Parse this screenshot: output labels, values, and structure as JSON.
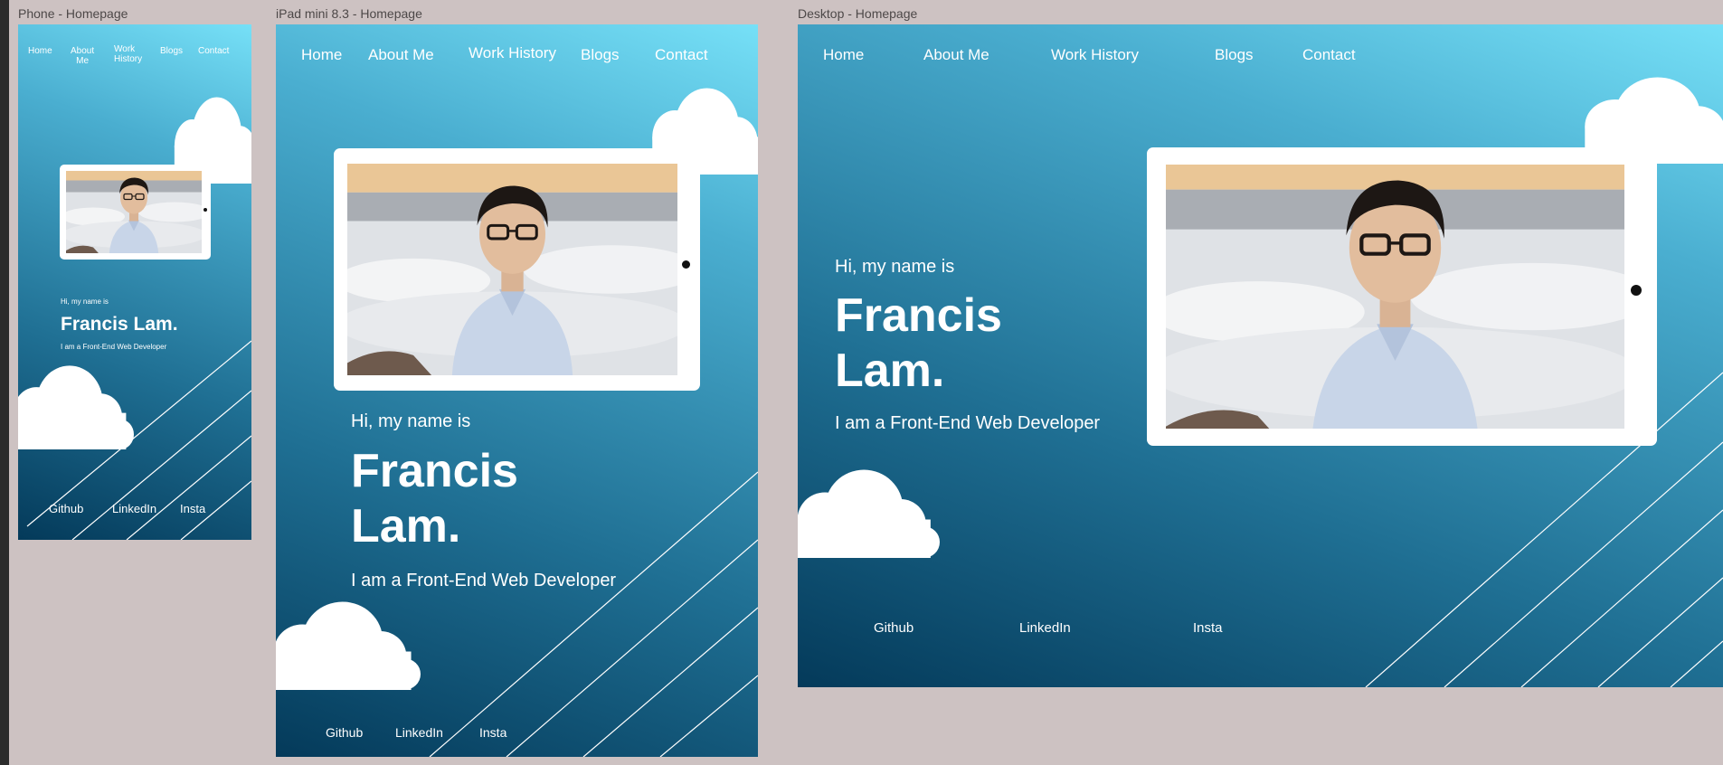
{
  "frames": {
    "phone": {
      "label": "Phone - Homepage",
      "nav": [
        {
          "label": "Home"
        },
        {
          "label_line1": "About",
          "label_line2": "Me"
        },
        {
          "label_line1": "Work",
          "label_line2": "History"
        },
        {
          "label": "Blogs"
        },
        {
          "label": "Contact"
        }
      ],
      "greeting": "Hi, my name is",
      "name": "Francis Lam.",
      "tagline": "I am a Front-End Web Developer",
      "footer": [
        "Github",
        "LinkedIn",
        "Insta"
      ]
    },
    "ipad": {
      "label": "iPad mini 8.3 - Homepage",
      "nav": [
        "Home",
        "About Me",
        "Work History",
        "Blogs",
        "Contact"
      ],
      "greeting": "Hi, my name is",
      "name_line1": "Francis",
      "name_line2": "Lam.",
      "tagline": "I am a Front-End Web Developer",
      "footer": [
        "Github",
        "LinkedIn",
        "Insta"
      ]
    },
    "desktop": {
      "label": "Desktop - Homepage",
      "nav": [
        "Home",
        "About Me",
        "Work History",
        "Blogs",
        "Contact"
      ],
      "greeting": "Hi, my name is",
      "name_line1": "Francis",
      "name_line2": "Lam.",
      "tagline": "I am a Front-End Web Developer",
      "footer": [
        "Github",
        "LinkedIn",
        "Insta"
      ]
    }
  },
  "colors": {
    "canvas": "#cdc2c2",
    "gradient_dark": "#043a5a",
    "gradient_light": "#76e0f7",
    "text": "#ffffff"
  }
}
